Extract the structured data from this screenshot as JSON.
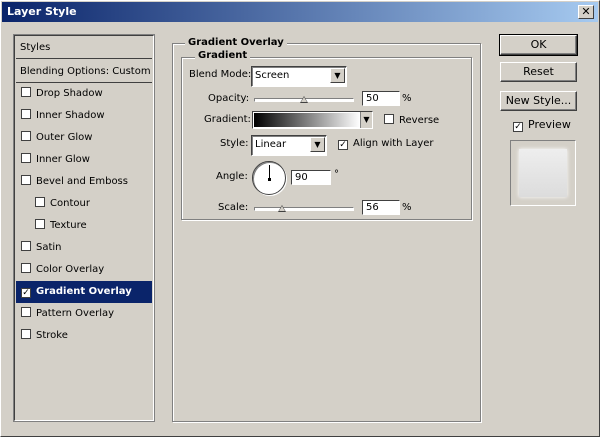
{
  "window": {
    "title": "Layer Style",
    "close_glyph": "✕"
  },
  "styles_list": {
    "header": "Styles",
    "blending": "Blending Options: Custom",
    "items": [
      {
        "label": "Drop Shadow",
        "checked": false,
        "indent": false,
        "selected": false
      },
      {
        "label": "Inner Shadow",
        "checked": false,
        "indent": false,
        "selected": false
      },
      {
        "label": "Outer Glow",
        "checked": false,
        "indent": false,
        "selected": false
      },
      {
        "label": "Inner Glow",
        "checked": false,
        "indent": false,
        "selected": false
      },
      {
        "label": "Bevel and Emboss",
        "checked": false,
        "indent": false,
        "selected": false
      },
      {
        "label": "Contour",
        "checked": false,
        "indent": true,
        "selected": false
      },
      {
        "label": "Texture",
        "checked": false,
        "indent": true,
        "selected": false
      },
      {
        "label": "Satin",
        "checked": false,
        "indent": false,
        "selected": false
      },
      {
        "label": "Color Overlay",
        "checked": false,
        "indent": false,
        "selected": false
      },
      {
        "label": "Gradient Overlay",
        "checked": true,
        "indent": false,
        "selected": true
      },
      {
        "label": "Pattern Overlay",
        "checked": false,
        "indent": false,
        "selected": false
      },
      {
        "label": "Stroke",
        "checked": false,
        "indent": false,
        "selected": false
      }
    ]
  },
  "panel": {
    "title": "Gradient Overlay",
    "section": "Gradient",
    "blend_mode_label": "Blend Mode:",
    "blend_mode_value": "Screen",
    "opacity_label": "Opacity:",
    "opacity_value": "50",
    "opacity_unit": "%",
    "opacity_fraction": 0.5,
    "gradient_label": "Gradient:",
    "reverse_label": "Reverse",
    "reverse_checked": false,
    "style_label": "Style:",
    "style_value": "Linear",
    "align_label": "Align with Layer",
    "align_checked": true,
    "angle_label": "Angle:",
    "angle_value": "90",
    "angle_unit": "°",
    "scale_label": "Scale:",
    "scale_value": "56",
    "scale_unit": "%",
    "scale_fraction": 0.28
  },
  "buttons": {
    "ok": "OK",
    "reset": "Reset",
    "new_style": "New Style...",
    "preview_label": "Preview",
    "preview_checked": true
  },
  "colors": {
    "selection": "#0a246a",
    "titlebar_start": "#0a246a",
    "titlebar_end": "#a6caf0"
  }
}
